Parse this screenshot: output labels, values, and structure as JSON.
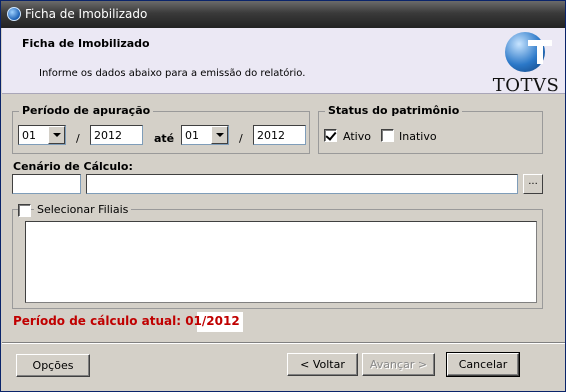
{
  "window": {
    "title": "Ficha de Imobilizado"
  },
  "header": {
    "title": "Ficha de Imobilizado",
    "subtitle": "Informe os dados abaixo para a emissão do relatório.",
    "logo_text": "TOTVS"
  },
  "periodo": {
    "legend": "Período de apuração",
    "from_month": "01",
    "from_year": "2012",
    "separator": "/",
    "ate_label": "até",
    "to_month": "01",
    "to_year": "2012"
  },
  "status": {
    "legend": "Status do patrimônio",
    "ativo_label": "Ativo",
    "ativo_checked": true,
    "inativo_label": "Inativo",
    "inativo_checked": false
  },
  "cenario": {
    "label": "Cenário de Cálculo:",
    "code_value": "",
    "description_value": "",
    "browse_label": "..."
  },
  "filiais": {
    "checkbox_label": "Selecionar Filiais",
    "checked": false
  },
  "status_line": "Período de cálculo atual: 01/2012",
  "buttons": {
    "options": "Opções",
    "back": "< Voltar",
    "next": "Avançar >",
    "cancel": "Cancelar"
  }
}
